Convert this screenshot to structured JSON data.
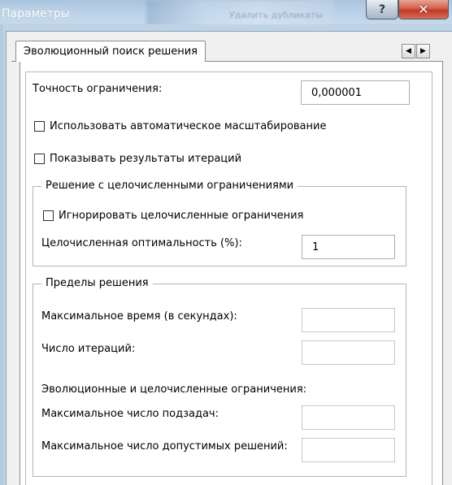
{
  "window": {
    "title": "Параметры",
    "background_text": "Удалить дубликаты",
    "help_label": "?",
    "close_label": "✕"
  },
  "tab": {
    "label": "Эволюционный поиск решения",
    "scroll_left": "◀",
    "scroll_right": "▶"
  },
  "constraint_precision": {
    "label": "Точность ограничения:",
    "value": "0,000001"
  },
  "checkboxes": {
    "auto_scaling": {
      "label": "Использовать автоматическое масштабирование",
      "checked": false
    },
    "show_iterations": {
      "label": "Показывать результаты итераций",
      "checked": false
    }
  },
  "integer_group": {
    "title": "Решение с целочисленными ограничениями",
    "ignore_label": "Игнорировать целочисленные ограничения",
    "ignore_checked": false,
    "optimality_label": "Целочисленная оптимальность (%):",
    "optimality_value": "1"
  },
  "limits_group": {
    "title": "Пределы решения",
    "max_time_label": "Максимальное время (в секундах):",
    "max_time_value": "",
    "iterations_label": "Число итераций:",
    "iterations_value": "",
    "evo_heading": "Эволюционные и целочисленные ограничения:",
    "max_subproblems_label": "Максимальное число подзадач:",
    "max_subproblems_value": "",
    "max_feasible_label": "Максимальное число допустимых решений:",
    "max_feasible_value": ""
  }
}
